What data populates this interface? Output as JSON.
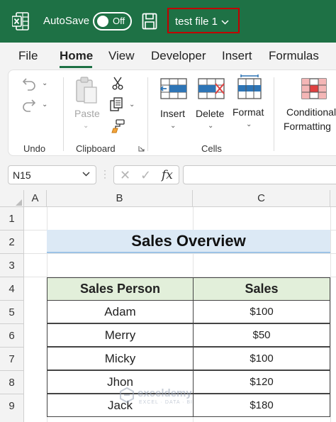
{
  "titlebar": {
    "autosave_label": "AutoSave",
    "toggle_state": "Off",
    "file_name": "test file 1",
    "file_chevron": "⌵",
    "colors": {
      "background": "#1e7145",
      "highlight_border": "#c00000"
    }
  },
  "tabs": [
    {
      "label": "File"
    },
    {
      "label": "Home",
      "active": true
    },
    {
      "label": "View"
    },
    {
      "label": "Developer"
    },
    {
      "label": "Insert"
    },
    {
      "label": "Formulas"
    }
  ],
  "ribbon": {
    "groups": {
      "undo": {
        "label": "Undo"
      },
      "clipboard": {
        "label": "Clipboard",
        "paste_label": "Paste"
      },
      "cells": {
        "label": "Cells",
        "insert_label": "Insert",
        "delete_label": "Delete",
        "format_label": "Format"
      },
      "styles": {
        "conditional_line1": "Conditional",
        "conditional_line2": "Formatting"
      }
    }
  },
  "formula_bar": {
    "name_box": "N15",
    "fx_label": "fx",
    "formula": ""
  },
  "grid": {
    "columns": [
      "A",
      "B",
      "C"
    ],
    "rows": [
      "1",
      "2",
      "3",
      "4",
      "5",
      "6",
      "7",
      "8",
      "9"
    ],
    "title": "Sales Overview",
    "table": {
      "headers": [
        "Sales Person",
        "Sales"
      ],
      "rows": [
        [
          "Adam",
          "$100"
        ],
        [
          "Merry",
          "$50"
        ],
        [
          "Micky",
          "$100"
        ],
        [
          "Jhon",
          "$120"
        ],
        [
          "Jack",
          "$180"
        ]
      ]
    }
  },
  "watermark": {
    "brand": "exceldemy",
    "tagline": "EXCEL · DATA · BI"
  }
}
